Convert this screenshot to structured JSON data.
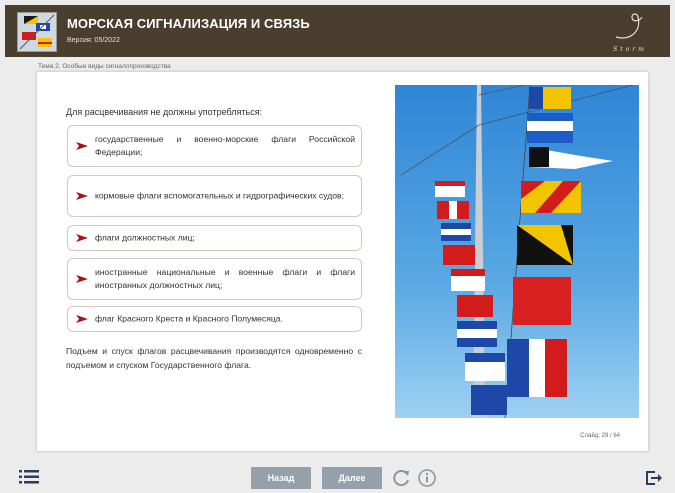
{
  "header": {
    "title": "МОРСКАЯ СИГНАЛИЗАЦИЯ И СВЯЗЬ",
    "version": "Версия: 05/2022",
    "brand": "Storm",
    "bg_color": "#4a3e2f"
  },
  "breadcrumb": "Тема 2. Особые виды сигналопроизводства",
  "content": {
    "intro": "Для расцвечивания не должны употребляться:",
    "items": [
      {
        "text": "государственные и военно-морские флаги Российской Федерации;"
      },
      {
        "text": "кормовые флаги вспомогательных и гидрографических судов;"
      },
      {
        "text": "флаги должностных лиц;"
      },
      {
        "text": "иностранные национальные и военные флаги и флаги иностранных должностных лиц;"
      },
      {
        "text": "флаг Красного Креста и Красного Полумесяца."
      }
    ],
    "footer": "Подъем и спуск флагов расцвечивания производятся одновременно с подъемом и спуском Государственного флага.",
    "arrow_color": "#a4121a"
  },
  "slide_counter": "Слайд: 29 / 64",
  "nav": {
    "back_label": "Назад",
    "next_label": "Далее",
    "button_color": "#95a0ab"
  },
  "icons": {
    "menu": "list-menu-icon",
    "reload": "reload-icon",
    "info": "info-icon",
    "exit": "exit-icon",
    "arrow": "arrow-right-icon"
  }
}
